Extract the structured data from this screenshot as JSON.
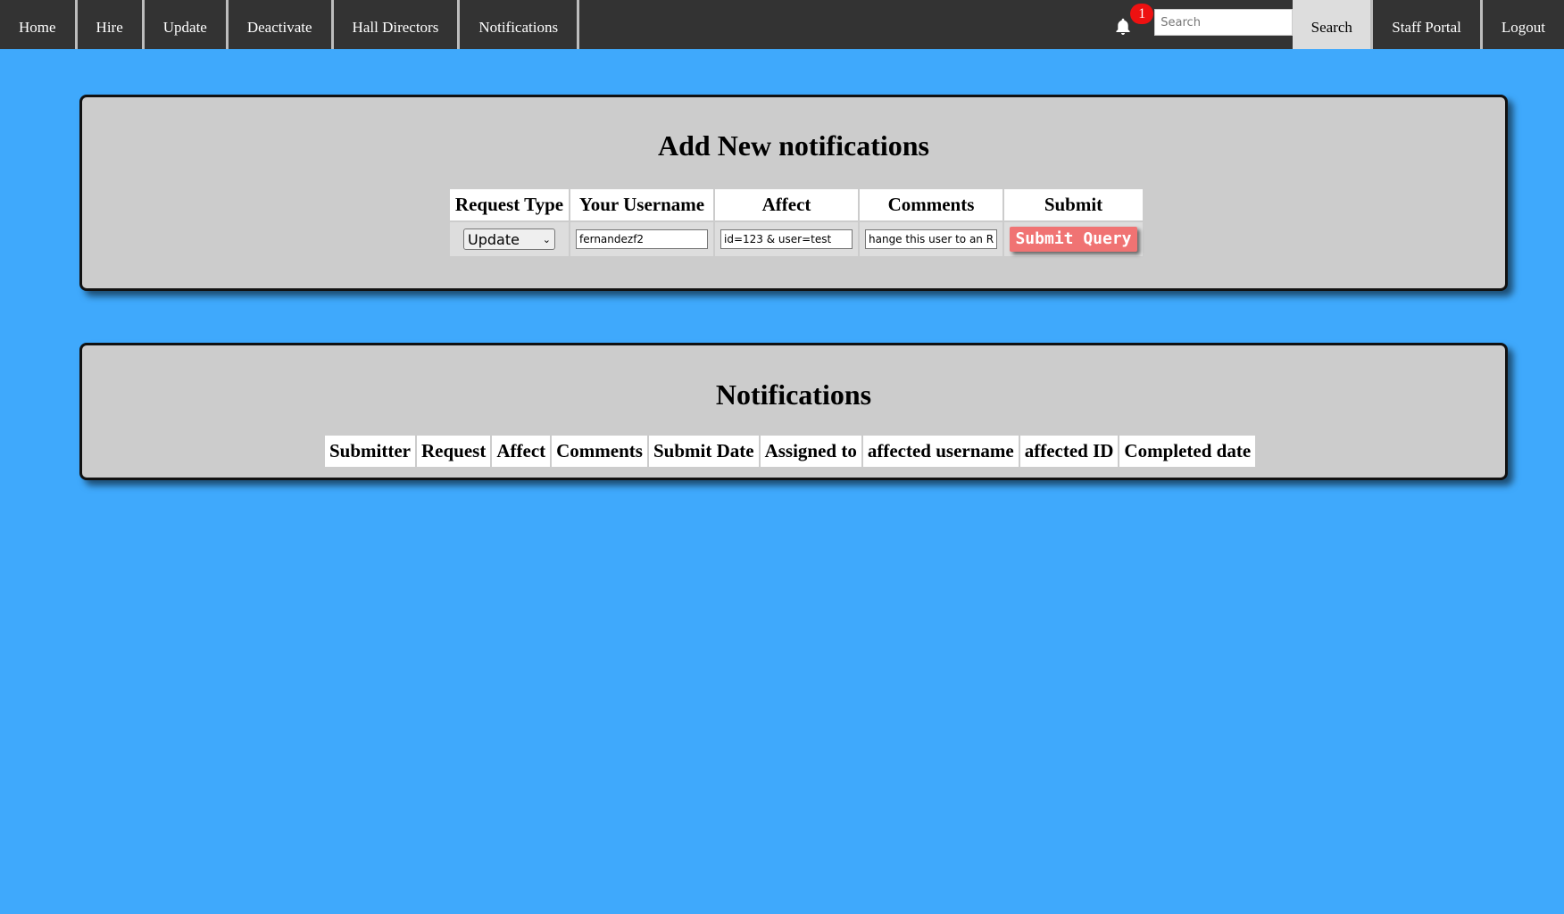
{
  "nav": {
    "items": [
      "Home",
      "Hire",
      "Update",
      "Deactivate",
      "Hall Directors",
      "Notifications"
    ],
    "bell_count": "1",
    "search_placeholder": "Search",
    "search_button": "Search",
    "staff_portal": "Staff Portal",
    "logout": "Logout"
  },
  "add_form": {
    "title": "Add New notifications",
    "headers": [
      "Request Type",
      "Your Username",
      "Affect",
      "Comments",
      "Submit"
    ],
    "request_type": "Update",
    "username": "fernandezf2",
    "affect": "id=123 & user=test",
    "comments": "hange this user to an RA",
    "submit_label": "Submit Query"
  },
  "notifications": {
    "title": "Notifications",
    "headers": [
      "Submitter",
      "Request",
      "Affect",
      "Comments",
      "Submit Date",
      "Assigned to",
      "affected username",
      "affected ID",
      "Completed date"
    ]
  },
  "colors": {
    "background": "#3fa9fc",
    "navbar": "#333333",
    "panel": "#cccccc",
    "submit": "#f07373",
    "badge": "#ee1111"
  }
}
